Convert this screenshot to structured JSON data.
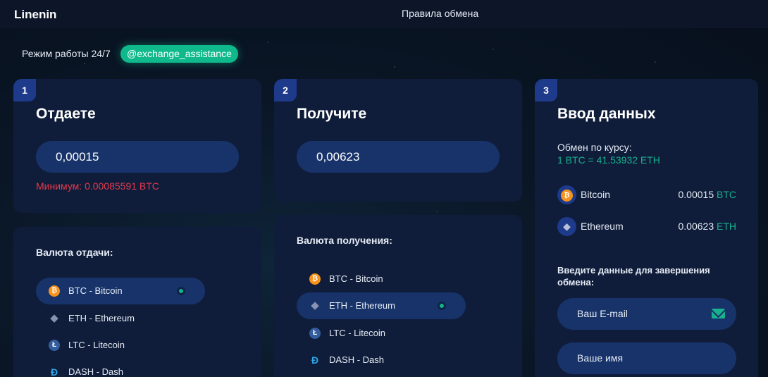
{
  "header": {
    "logo": "Linenin",
    "rules_link": "Правила обмена"
  },
  "topbar": {
    "work_hours": "Режим работы 24/7",
    "telegram": "@exchange_assistance"
  },
  "give": {
    "step": "1",
    "title": "Отдаете",
    "amount": "0,00015",
    "minimum": "Минимум: 0.00085591 BTC",
    "list_title": "Валюта отдачи:",
    "currencies": [
      {
        "label": "BTC - Bitcoin",
        "icon": "bitcoin-icon",
        "selected": true
      },
      {
        "label": "ETH - Ethereum",
        "icon": "ethereum-icon",
        "selected": false
      },
      {
        "label": "LTC - Litecoin",
        "icon": "litecoin-icon",
        "selected": false
      },
      {
        "label": "DASH - Dash",
        "icon": "dash-icon",
        "selected": false
      }
    ]
  },
  "receive": {
    "step": "2",
    "title": "Получите",
    "amount": "0,00623",
    "list_title": "Валюта получения:",
    "currencies": [
      {
        "label": "BTC - Bitcoin",
        "icon": "bitcoin-icon",
        "selected": false
      },
      {
        "label": "ETH - Ethereum",
        "icon": "ethereum-icon",
        "selected": true
      },
      {
        "label": "LTC - Litecoin",
        "icon": "litecoin-icon",
        "selected": false
      },
      {
        "label": "DASH - Dash",
        "icon": "dash-icon",
        "selected": false
      }
    ]
  },
  "details": {
    "step": "3",
    "title": "Ввод данных",
    "rate_label": "Обмен по курсу:",
    "rate_value": "1 BTC = 41.53932 ETH",
    "summary": [
      {
        "name": "Bitcoin",
        "amount": "0.00015",
        "code": "BTC",
        "icon": "bitcoin-icon"
      },
      {
        "name": "Ethereum",
        "amount": "0.00623",
        "code": "ETH",
        "icon": "ethereum-icon"
      }
    ],
    "complete_title": "Введите данные для завершения обмена:",
    "email_placeholder": "Ваш E-mail",
    "name_placeholder": "Ваше имя"
  },
  "colors": {
    "accent": "#0fb98b",
    "error": "#e3394d",
    "card": "#0f1d3a",
    "input": "#17336a"
  }
}
